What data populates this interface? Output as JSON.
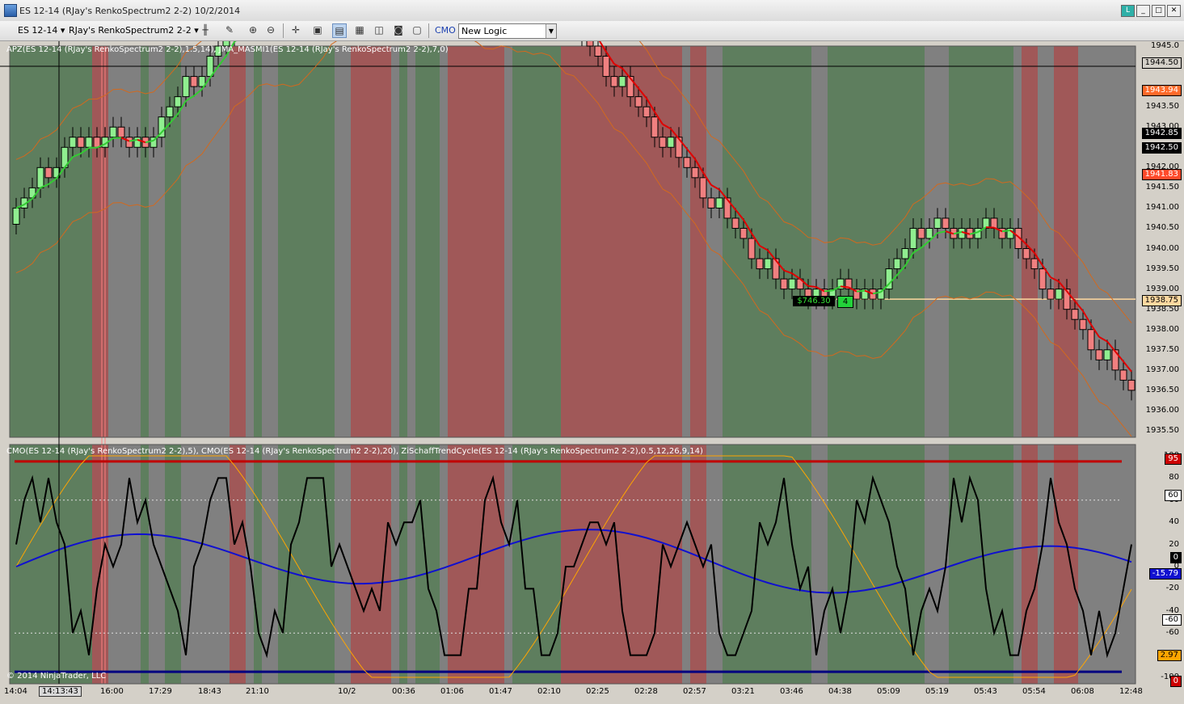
{
  "window": {
    "title": "ES 12-14 (RJay's RenkoSpectrum2  2-2)  10/2/2014"
  },
  "toolbar": {
    "instrument": "ES 12-14",
    "bar_type": "RJay's RenkoSpectrum2  2-2",
    "indicator_label": "CMO",
    "strategy_select": "New Logic",
    "icons": [
      "bar-style-icon",
      "draw-tool-icon",
      "zoom-in-icon",
      "zoom-out-icon",
      "crosshair-icon",
      "data-box-icon",
      "chart-trader-icon",
      "properties-icon",
      "strategies-icon",
      "snapshot-icon",
      "template-icon"
    ]
  },
  "price_panel": {
    "title": "APZ(ES 12-14 (RJay's RenkoSpectrum2  2-2),1.5,14), JMA_MASMI1(ES 12-14 (RJay's RenkoSpectrum2  2-2),7,0)",
    "y_labels": [
      "1945.0",
      "1944.50",
      "1943.50",
      "1943.00",
      "1942.50",
      "1942.00",
      "1941.50",
      "1941.00",
      "1940.50",
      "1940.00",
      "1939.50",
      "1939.00",
      "1938.50",
      "1938.00",
      "1937.50",
      "1937.00",
      "1936.50",
      "1936.00",
      "1935.50"
    ],
    "last_price": "1944.50",
    "apz_upper": "1943.94",
    "close_a": "1942.85",
    "close_b": "1942.50",
    "apz_lower": "1941.83",
    "entry_price": "1938.75",
    "pnl": "$746.30",
    "quantity": "4"
  },
  "indicator_panel": {
    "title": "CMO(ES 12-14 (RJay's RenkoSpectrum2  2-2),5), CMO(ES 12-14 (RJay's RenkoSpectrum2  2-2),20), ZiSchaffTrendCycle(ES 12-14 (RJay's RenkoSpectrum2  2-2),0.5,12,26,9,14)",
    "y_labels": [
      "100",
      "80",
      "60",
      "40",
      "20",
      "0",
      "-20",
      "-40",
      "-60",
      "-80",
      "-100"
    ],
    "upper_level": "95",
    "upper_dotted": "60",
    "zero_marker": "0",
    "cmo20_value": "-15.79",
    "lower_dotted": "-60",
    "stc_value": "2.97",
    "bottom_marker": "0"
  },
  "x_axis": {
    "cursor_time": "14:13:43",
    "labels": [
      "14:04",
      "16:00",
      "17:29",
      "18:43",
      "21:10",
      "10/2",
      "00:36",
      "01:06",
      "01:47",
      "02:10",
      "02:25",
      "02:28",
      "02:57",
      "03:21",
      "03:46",
      "04:38",
      "05:09",
      "05:19",
      "05:43",
      "05:54",
      "06:08",
      "12:48"
    ]
  },
  "copyright": "© 2014 NinjaTrader, LLC",
  "colors": {
    "bg_gray": "#808080",
    "green_zone": "#5e7e5e",
    "red_zone": "#a05858",
    "bull_candle": "#90ee90",
    "bear_candle": "#f08080",
    "cmo5": "#000000",
    "cmo20": "#1010d0",
    "stc": "#ffa500",
    "jma_up": "#33cc33",
    "jma_down": "#e00000",
    "apz_band": "#d2691e"
  }
}
